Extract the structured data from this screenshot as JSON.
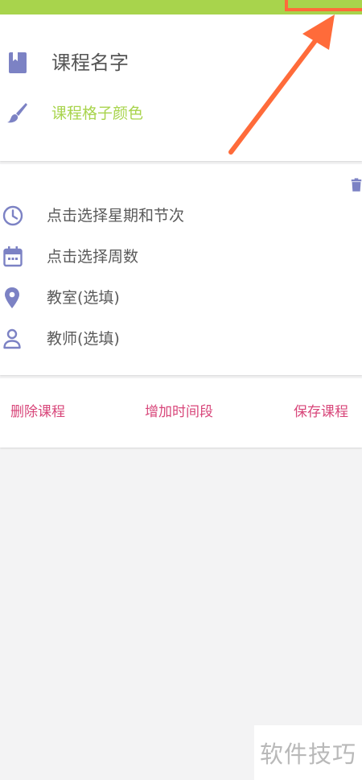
{
  "course": {
    "name_placeholder": "课程名字",
    "color_label": "课程格子颜色"
  },
  "time_slot": {
    "weekday_section": "点击选择星期和节次",
    "weeks": "点击选择周数",
    "classroom": "教室(选填)",
    "teacher": "教师(选填)"
  },
  "actions": {
    "delete_course": "删除课程",
    "add_time_slot": "增加时间段",
    "save_course": "保存课程"
  },
  "watermark": "软件技巧",
  "colors": {
    "accent_green": "#a8d44c",
    "icon_purple": "#7c82c4",
    "action_pink": "#d8467a",
    "annotation_orange": "#ff6b3a"
  },
  "icons": {
    "course_name": "book-icon",
    "color": "brush-icon",
    "delete": "trash-icon",
    "time": "clock-icon",
    "weeks": "calendar-icon",
    "classroom": "location-pin-icon",
    "teacher": "person-icon"
  }
}
